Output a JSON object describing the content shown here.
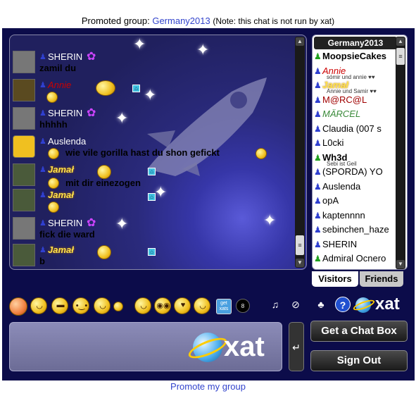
{
  "promo": {
    "prefix": "Promoted group:",
    "group": "Germany2013",
    "note": "(Note: this chat is not run by xat)"
  },
  "messages": [
    {
      "name": "SHERIN",
      "text": "zamil du",
      "style": "normal"
    },
    {
      "name": "Annie",
      "text": "",
      "style": "annie"
    },
    {
      "name": "SHERIN",
      "text": "hhhhh",
      "style": "normal"
    },
    {
      "name": "Auslenda",
      "text": "wie vile gorilla hast du shon gefickt",
      "style": "normal"
    },
    {
      "name": "Jamał",
      "text": "",
      "style": "jamal"
    },
    {
      "name": "Jamał",
      "text": "mit dir einezogen",
      "style": "jamal"
    },
    {
      "name": "Jamał",
      "text": "",
      "style": "jamal"
    },
    {
      "name": "SHERIN",
      "text": "fick die ward",
      "style": "normal"
    },
    {
      "name": "Jamał",
      "text": "b",
      "style": "jamal"
    }
  ],
  "userlist": {
    "header": "Germany2013",
    "users": [
      {
        "name": "MoopsieCakes",
        "style": "bold",
        "sub": ""
      },
      {
        "name": "Annie",
        "style": "annie",
        "sub": "sómir und annie ♥♥"
      },
      {
        "name": "Jamał",
        "style": "jamal",
        "sub": "Annie und Samir ♥♥"
      },
      {
        "name": "M@RC@L",
        "style": "marcel",
        "sub": ""
      },
      {
        "name": "MÄRCEL",
        "style": "marcel2",
        "sub": ""
      },
      {
        "name": "Claudia   (007 s",
        "style": "normal",
        "sub": ""
      },
      {
        "name": "L0cki",
        "style": "normal",
        "sub": ""
      },
      {
        "name": "Wh3d",
        "style": "bold",
        "sub": "Sebi ist Geil"
      },
      {
        "name": "(SPORDA) YO",
        "style": "normal",
        "sub": ""
      },
      {
        "name": "Auslenda",
        "style": "normal",
        "sub": ""
      },
      {
        "name": "opA",
        "style": "normal",
        "sub": ""
      },
      {
        "name": "kaptennnn",
        "style": "normal",
        "sub": ""
      },
      {
        "name": "sebinchen_haze",
        "style": "normal",
        "sub": ""
      },
      {
        "name": "SHERIN",
        "style": "normal",
        "sub": ""
      },
      {
        "name": "Admiral Ocnero",
        "style": "normal",
        "sub": ""
      }
    ]
  },
  "tabs": {
    "visitors": "Visitors",
    "friends": "Friends"
  },
  "buttons": {
    "get_chat": "Get a Chat Box",
    "sign_out": "Sign Out",
    "send": "↵"
  },
  "toolbar": {
    "getxats": "get xats",
    "help": "?",
    "logo": "xat"
  },
  "input_logo": "xat",
  "promote_link": "Promote my group",
  "colors": {
    "background": "#0c0c4a",
    "accent": "#3344cc"
  }
}
